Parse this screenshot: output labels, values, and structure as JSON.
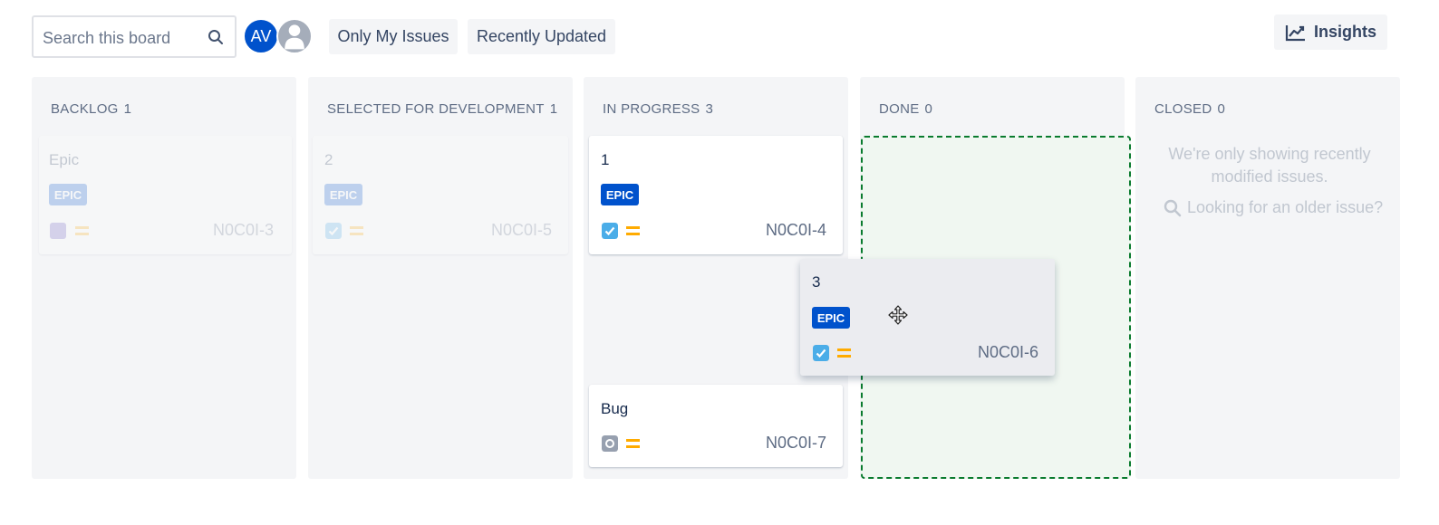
{
  "toolbar": {
    "search_placeholder": "Search this board",
    "avatars": [
      {
        "initials": "AV",
        "color": "#0052cc"
      },
      {
        "initials": "",
        "kind": "default-user"
      }
    ],
    "quick_filters": [
      "Only My Issues",
      "Recently Updated"
    ],
    "insights_label": "Insights"
  },
  "columns": [
    {
      "name": "BACKLOG",
      "count": "1"
    },
    {
      "name": "SELECTED FOR DEVELOPMENT",
      "count": "1"
    },
    {
      "name": "IN PROGRESS",
      "count": "3"
    },
    {
      "name": "DONE",
      "count": "0"
    },
    {
      "name": "CLOSED",
      "count": "0"
    }
  ],
  "cards": {
    "backlog_epic": {
      "title": "Epic",
      "label": "EPIC",
      "type": "story",
      "priority": "medium",
      "key": "N0C0I-3"
    },
    "selected_2": {
      "title": "2",
      "label": "EPIC",
      "type": "task",
      "priority": "medium",
      "key": "N0C0I-5"
    },
    "inprogress_1": {
      "title": "1",
      "label": "EPIC",
      "type": "task",
      "priority": "medium",
      "key": "N0C0I-4"
    },
    "dragging_3": {
      "title": "3",
      "label": "EPIC",
      "type": "task",
      "priority": "medium",
      "key": "N0C0I-6"
    },
    "inprogress_bug": {
      "title": "Bug",
      "type": "bug",
      "priority": "medium",
      "key": "N0C0I-7"
    }
  },
  "closed_column": {
    "empty_message": "We're only showing recently modified issues.",
    "older_issue_link": "Looking for an older issue?"
  },
  "colors": {
    "epic_badge": "#0052cc",
    "priority_medium": "#ffab00",
    "task_icon": "#4bade8",
    "drop_zone_border": "#0a7b2e"
  }
}
